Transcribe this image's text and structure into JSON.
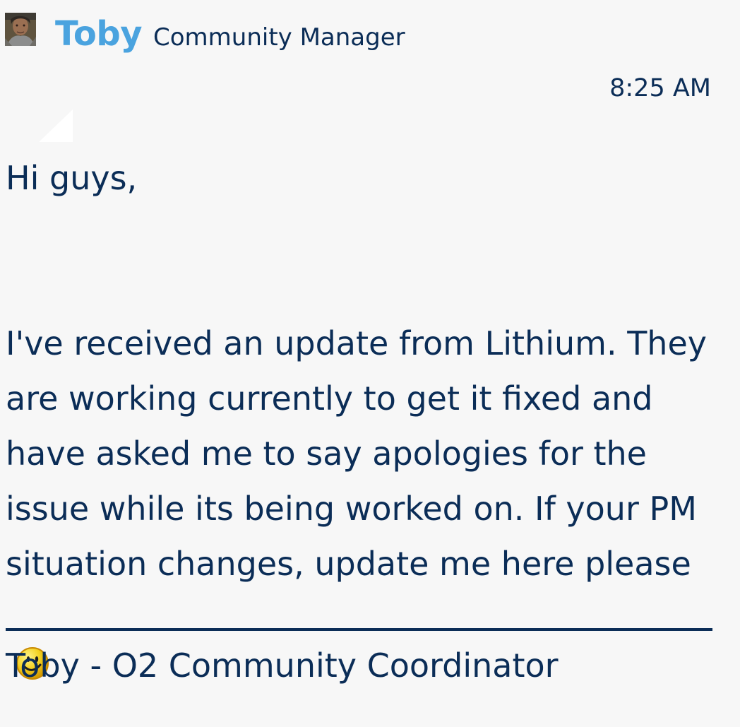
{
  "post": {
    "author_name": "Toby",
    "author_rank": "Community Manager",
    "time": "8:25 AM",
    "greeting": "Hi guys,",
    "body": "I've received an update from Lithium. They are working currently to get it fixed and have asked me to say apologies for the issue while its being worked on. If your PM situation changes, update me here please",
    "signature": "Toby - O2 Community Coordinator"
  },
  "icons": {
    "avatar": "user-avatar",
    "emoticon": "smiley-icon"
  },
  "colors": {
    "background": "#f7f7f7",
    "author_link": "#4aa3df",
    "text": "#0b2d57"
  }
}
